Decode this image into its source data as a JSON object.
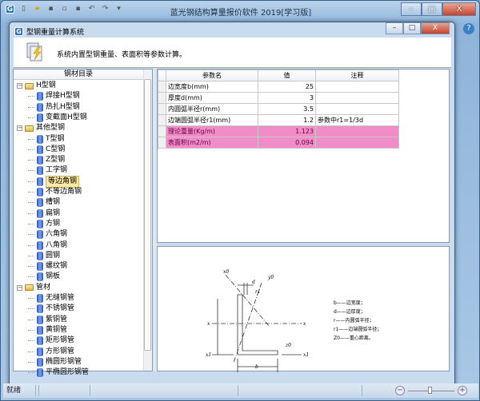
{
  "app": {
    "title": "蓝光钢结构算量报价软件 2019[学习版]",
    "window_buttons": [
      "minimize",
      "maximize",
      "close"
    ]
  },
  "quick_access": [
    "app-logo-icon",
    "new-icon",
    "open-icon",
    "save-icon",
    "print-preview-icon",
    "print-icon",
    "undo-icon",
    "redo-icon",
    "customize-icon"
  ],
  "dialog": {
    "title": "型钢重量计算系统",
    "description": "系统内置型钢重量、表面积等参数计算。"
  },
  "tree": {
    "header": "钢材目录",
    "groups": [
      {
        "label": "H型钢",
        "items": [
          "焊接H型钢",
          "热扎H型钢",
          "变截面H型钢"
        ]
      },
      {
        "label": "其他型钢",
        "items": [
          "T型钢",
          "C型钢",
          "Z型钢",
          "工字钢",
          "等边角钢",
          "不等边角钢",
          "槽钢",
          "扁钢",
          "方钢",
          "六角钢",
          "八角钢",
          "圆钢",
          "螺纹钢",
          "钢板"
        ]
      },
      {
        "label": "管材",
        "items": [
          "无缝钢管",
          "不锈钢管",
          "紫铜管",
          "黄铜管",
          "矩形钢管",
          "方形钢管",
          "椭圆形钢管",
          "平椭圆形钢管"
        ]
      }
    ],
    "selected": "等边角钢"
  },
  "grid": {
    "columns": [
      "参数名",
      "值",
      "注释"
    ],
    "rows": [
      {
        "name": "边宽度b(mm)",
        "value": "25",
        "note": "",
        "highlight": false
      },
      {
        "name": "厚度d(mm)",
        "value": "3",
        "note": "",
        "highlight": false
      },
      {
        "name": "内圆弧半径r(mm)",
        "value": "3.5",
        "note": "",
        "highlight": false
      },
      {
        "name": "边端圆弧半径r1(mm)",
        "value": "1.2",
        "note": "参数中r1=1/3d",
        "highlight": false
      },
      {
        "name": "理论重量(Kg/m)",
        "value": "1.123",
        "note": "",
        "highlight": true
      },
      {
        "name": "表面积(m2/m)",
        "value": "0.094",
        "note": "",
        "highlight": true
      }
    ],
    "highlight_color": "#f08cc8"
  },
  "diagram": {
    "legend": [
      "b——边宽度；",
      "d——边厚度；",
      "r——内圆弧半径；",
      "r1——边端圆弧半径；",
      "Z0——重心距离。"
    ],
    "labels": {
      "d": "d",
      "r1": "r1",
      "b": "b",
      "x": "x",
      "x1": "x1",
      "x0": "x0",
      "y0": "y0",
      "z0": "z0"
    }
  },
  "status": {
    "text": "就绪"
  }
}
